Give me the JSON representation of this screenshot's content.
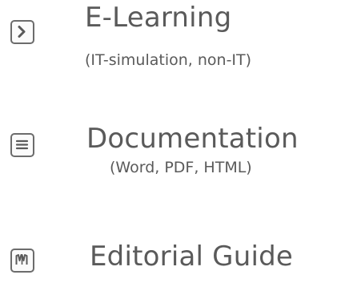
{
  "items": [
    {
      "icon": "chevron-right-box-icon",
      "title": "E-Learning",
      "subtitle": "(IT-simulation, non-IT)"
    },
    {
      "icon": "document-lines-icon",
      "title": "Documentation",
      "subtitle": "(Word, PDF, HTML)"
    },
    {
      "icon": "book-icon",
      "title": "Editorial Guide"
    }
  ],
  "colors": {
    "text": "#5a5a5a",
    "icon_stroke": "#6c6c6c",
    "background": "#ffffff"
  }
}
